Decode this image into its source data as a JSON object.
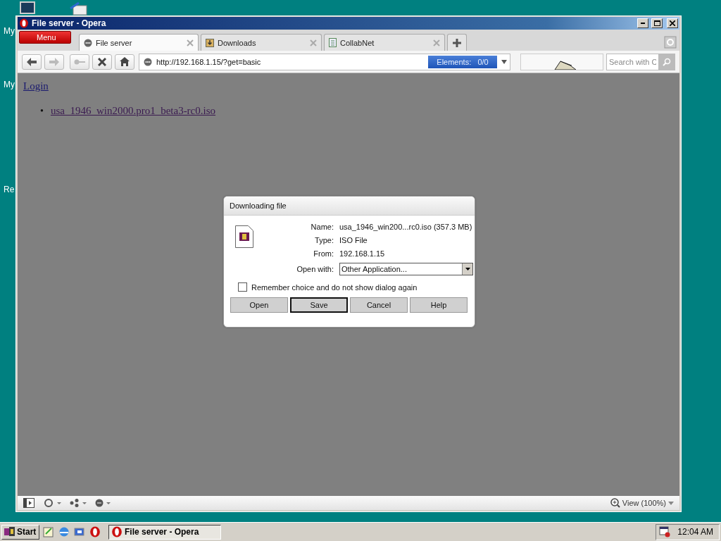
{
  "desktop_icons": [
    {
      "label": "My"
    },
    {
      "label": "My"
    },
    {
      "label": "Re"
    }
  ],
  "window": {
    "title": "File server - Opera",
    "menu_button": "Menu",
    "tabs": [
      {
        "label": "File server",
        "selected": true,
        "kind": "globe"
      },
      {
        "label": "Downloads",
        "selected": false,
        "kind": "download"
      },
      {
        "label": "CollabNet",
        "selected": false,
        "kind": "page"
      }
    ],
    "address": "http://192.168.1.15/?get=basic",
    "elements_badge": "Elements:   0/0",
    "search_placeholder": "Search with C",
    "page": {
      "login_link": "Login",
      "files": [
        {
          "bullet": "•",
          "name": "usa_1946_win2000.pro1_beta3-rc0.iso"
        }
      ]
    },
    "dialog": {
      "title": "Downloading file",
      "fields": [
        {
          "label": "Name:",
          "value": "usa_1946_win200...rc0.iso (357.3 MB)"
        },
        {
          "label": "Type:",
          "value": "ISO File"
        },
        {
          "label": "From:",
          "value": "192.168.1.15"
        }
      ],
      "open_with": {
        "label": "Open with:",
        "value": "Other Application..."
      },
      "remember": {
        "label": "Remember choice and do not show dialog again",
        "checked": false
      },
      "buttons": [
        {
          "label": "Open",
          "default": false
        },
        {
          "label": "Save",
          "default": true
        },
        {
          "label": "Cancel",
          "default": false
        },
        {
          "label": "Help",
          "default": false
        }
      ]
    },
    "status_bar": {
      "zoom": "View (100%)"
    }
  },
  "taskbar": {
    "start": "Start",
    "tasks": [
      {
        "label": "File server - Opera",
        "selected": true
      }
    ],
    "clock": "12:04 AM"
  }
}
